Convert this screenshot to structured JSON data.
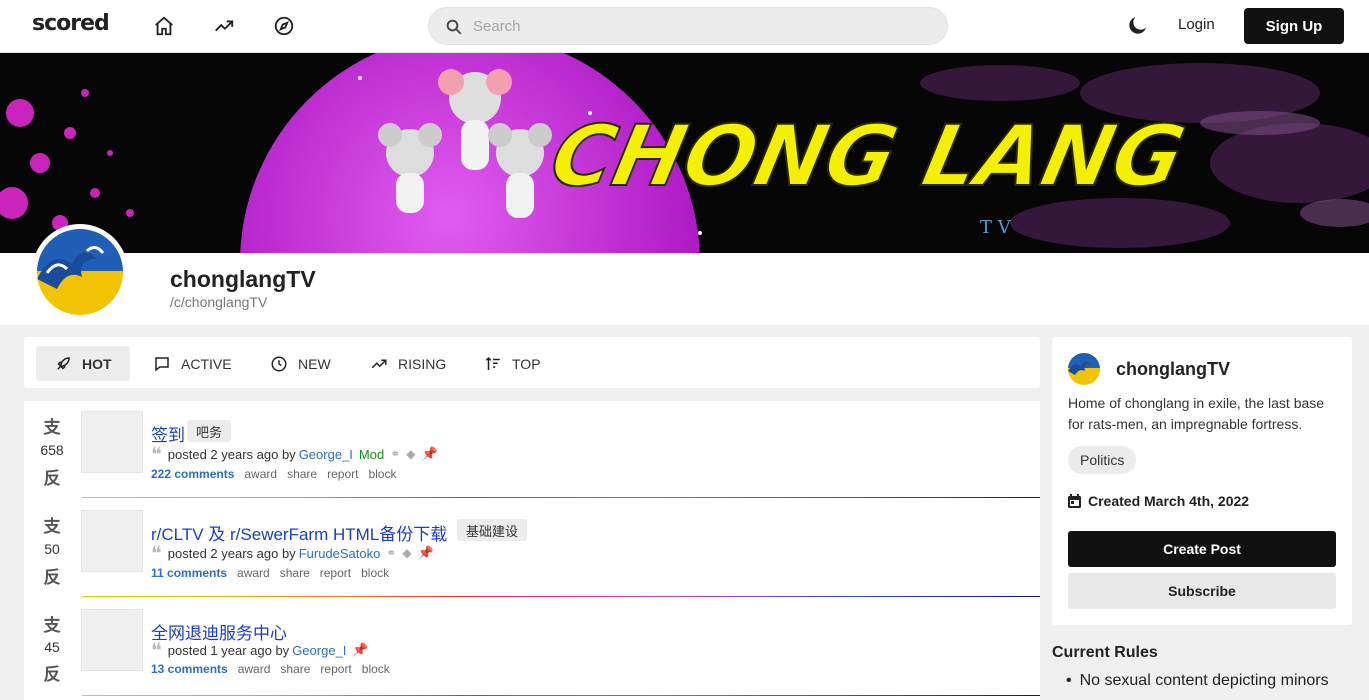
{
  "nav": {
    "logo": "scored",
    "search_placeholder": "Search",
    "login_label": "Login",
    "signup_label": "Sign Up",
    "icons": [
      "home-icon",
      "trending-icon",
      "compass-icon",
      "moon-icon"
    ]
  },
  "community": {
    "name": "chonglangTV",
    "path": "/c/chonglangTV",
    "banner_text": "CHONG LANG",
    "banner_sub": "T V"
  },
  "sort": {
    "tabs": [
      {
        "label": "HOT",
        "icon": "rocket-icon",
        "active": true
      },
      {
        "label": "ACTIVE",
        "icon": "comment-icon",
        "active": false
      },
      {
        "label": "NEW",
        "icon": "clock-icon",
        "active": false
      },
      {
        "label": "RISING",
        "icon": "trending-icon",
        "active": false
      },
      {
        "label": "TOP",
        "icon": "sort-icon",
        "active": false
      }
    ]
  },
  "posts": [
    {
      "vote_up": "支",
      "score": "658",
      "vote_down": "反",
      "title": "签到",
      "flair": "吧务",
      "posted": "posted 2 years ago by",
      "author": "George_I",
      "mod": "Mod",
      "comments": "222 comments",
      "actions": [
        "award",
        "share",
        "report",
        "block"
      ]
    },
    {
      "vote_up": "支",
      "score": "50",
      "vote_down": "反",
      "title": "r/CLTV 及 r/SewerFarm HTML备份下载",
      "flair": "基础建设",
      "posted": "posted 2 years ago by",
      "author": "FurudeSatoko",
      "mod": "",
      "comments": "11 comments",
      "actions": [
        "award",
        "share",
        "report",
        "block"
      ]
    },
    {
      "vote_up": "支",
      "score": "45",
      "vote_down": "反",
      "title": "全网退迪服务中心",
      "flair": "",
      "posted": "posted 1 year ago by",
      "author": "George_I",
      "mod": "",
      "comments": "13 comments",
      "actions": [
        "award",
        "share",
        "report",
        "block"
      ]
    }
  ],
  "sidebar": {
    "name": "chonglangTV",
    "description": "Home of chonglang in exile, the last base for rats-men, an impregnable fortress.",
    "tag": "Politics",
    "created": "Created March 4th, 2022",
    "create_post_label": "Create Post",
    "subscribe_label": "Subscribe",
    "rules_title": "Current Rules",
    "rules": [
      "No sexual content depicting minors"
    ]
  },
  "colors": {
    "link": "#1a3fc8",
    "user": "#2f6fbf",
    "mod": "#1a8c1a",
    "pin": "#e8b800",
    "banner_magenta": "#d12fe0",
    "banner_yellow": "#f4f000"
  }
}
